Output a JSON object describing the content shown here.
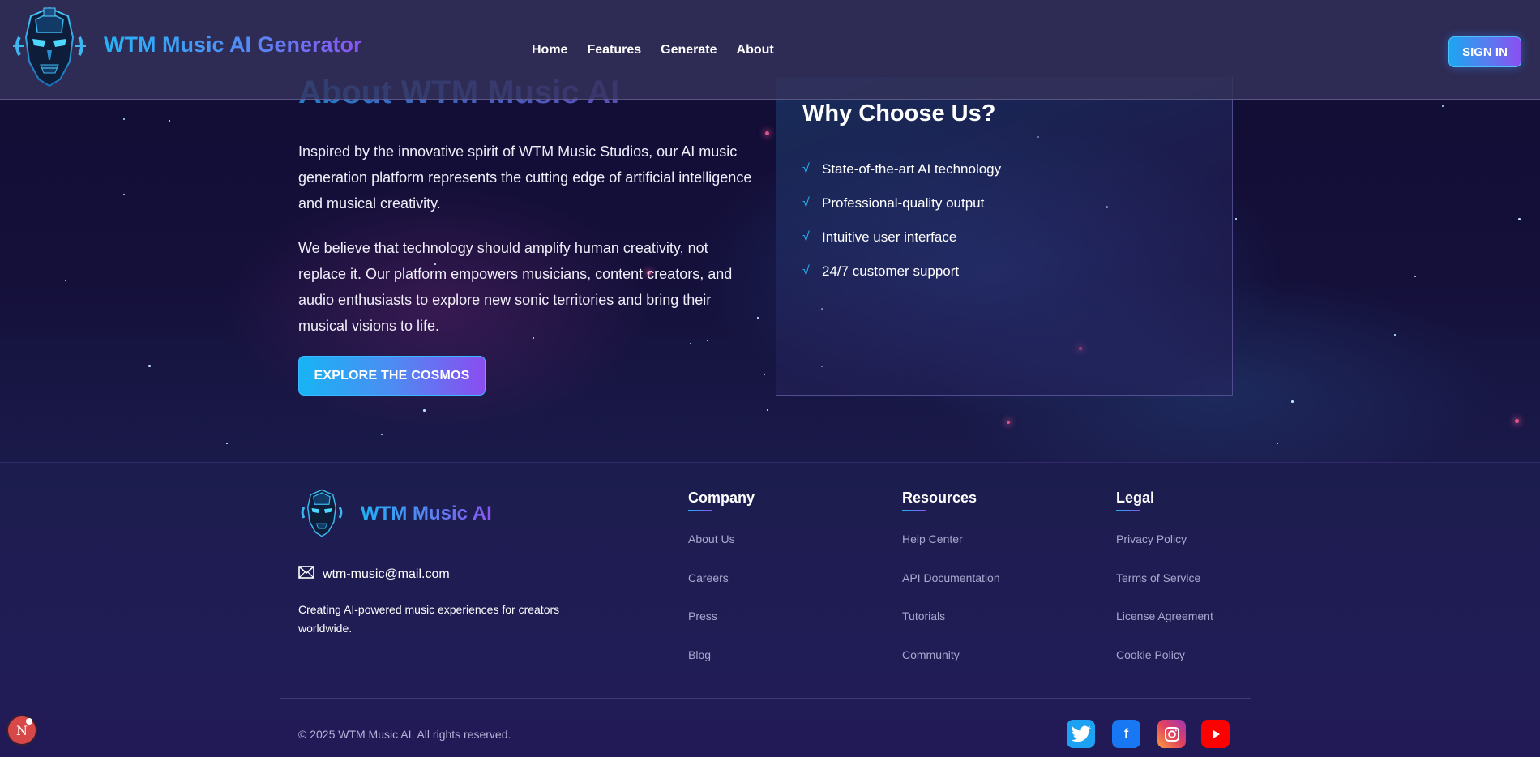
{
  "header": {
    "brand": "WTM Music AI Generator",
    "nav": [
      "Home",
      "Features",
      "Generate",
      "About"
    ],
    "signin_label": "SIGN IN"
  },
  "about": {
    "title": "About WTM Music AI",
    "paragraph1": "Inspired by the innovative spirit of WTM Music Studios, our AI music generation platform represents the cutting edge of artificial intelligence and musical creativity.",
    "paragraph2": "We believe that technology should amplify human creativity, not replace it. Our platform empowers musicians, content creators, and audio enthusiasts to explore new sonic territories and bring their musical visions to life.",
    "cta_label": "EXPLORE THE COSMOS"
  },
  "why": {
    "title": "Why Choose Us?",
    "items": [
      "State-of-the-art AI technology",
      "Professional-quality output",
      "Intuitive user interface",
      "24/7 customer support"
    ],
    "check_glyph": "√"
  },
  "footer": {
    "brand": "WTM Music AI",
    "email": "wtm-music@mail.com",
    "tagline": "Creating AI-powered music experiences for creators worldwide.",
    "columns": [
      {
        "title": "Company",
        "links": [
          "About Us",
          "Careers",
          "Press",
          "Blog"
        ]
      },
      {
        "title": "Resources",
        "links": [
          "Help Center",
          "API Documentation",
          "Tutorials",
          "Community"
        ]
      },
      {
        "title": "Legal",
        "links": [
          "Privacy Policy",
          "Terms of Service",
          "License Agreement",
          "Cookie Policy"
        ]
      }
    ],
    "copyright": "© 2025 WTM Music AI. All rights reserved.",
    "social": [
      "twitter-icon",
      "facebook-icon",
      "instagram-icon",
      "youtube-icon"
    ]
  },
  "badge": {
    "letter": "N"
  },
  "colors": {
    "accent_start": "#22b0f4",
    "accent_end": "#8a55f0",
    "background": "#130f38",
    "check": "#27b6f5"
  }
}
